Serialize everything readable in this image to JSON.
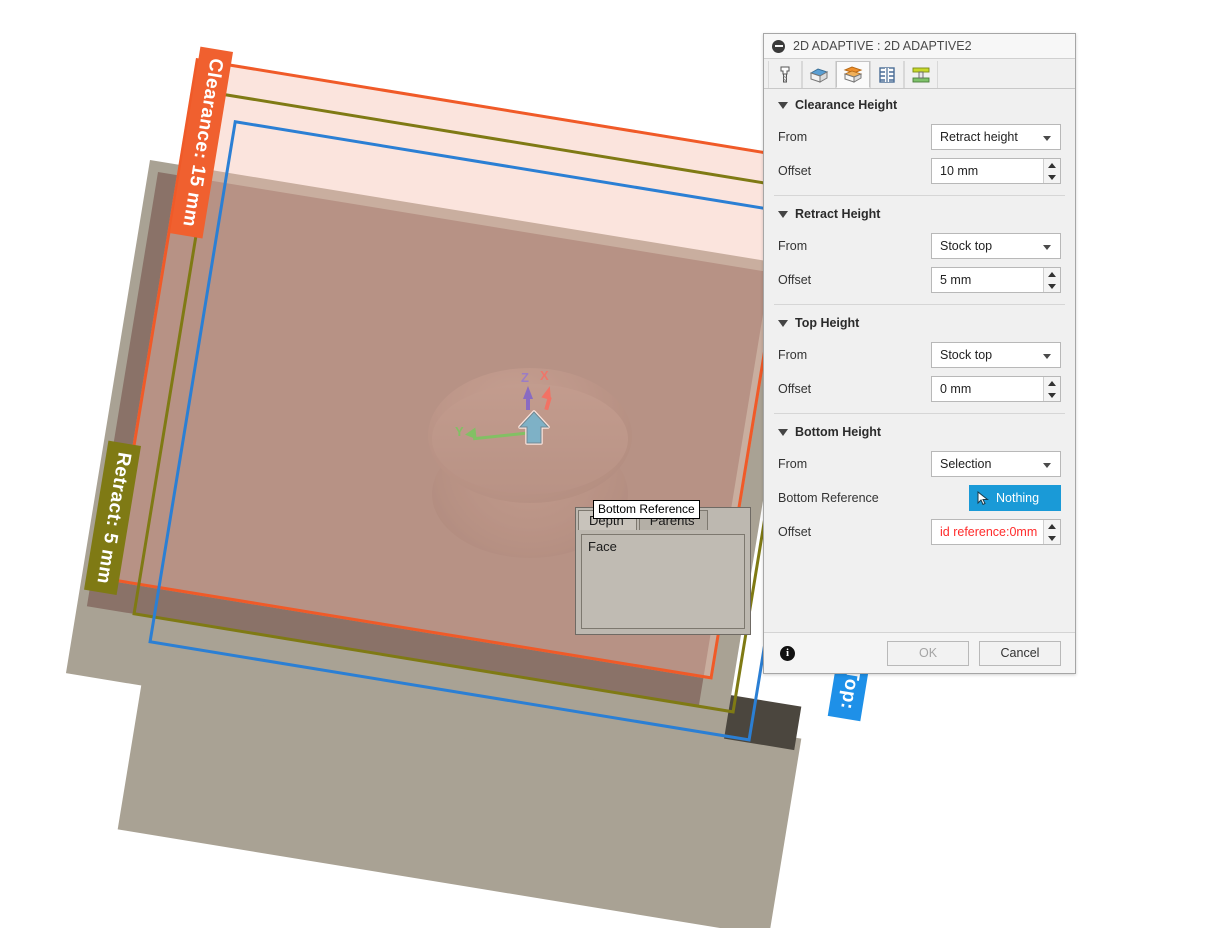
{
  "dialog": {
    "title": "2D ADAPTIVE : 2D ADAPTIVE2",
    "collapse_icon": "collapse-icon",
    "tabs": [
      {
        "name": "tool",
        "icon": "tool-icon",
        "active": false
      },
      {
        "name": "geometry",
        "icon": "geometry-icon",
        "active": false
      },
      {
        "name": "heights",
        "icon": "heights-icon",
        "active": true
      },
      {
        "name": "passes",
        "icon": "passes-icon",
        "active": false
      },
      {
        "name": "linking",
        "icon": "linking-icon",
        "active": false
      }
    ],
    "sections": [
      {
        "title": "Clearance Height",
        "from_label": "From",
        "from_value": "Retract height",
        "offset_label": "Offset",
        "offset_value": "10 mm"
      },
      {
        "title": "Retract Height",
        "from_label": "From",
        "from_value": "Stock top",
        "offset_label": "Offset",
        "offset_value": "5 mm"
      },
      {
        "title": "Top Height",
        "from_label": "From",
        "from_value": "Stock top",
        "offset_label": "Offset",
        "offset_value": "0 mm"
      },
      {
        "title": "Bottom Height",
        "from_label": "From",
        "from_value": "Selection",
        "reference_label": "Bottom Reference",
        "reference_value": "Nothing",
        "offset_label": "Offset",
        "offset_value": "id reference:0mm"
      }
    ],
    "footer": {
      "info_icon": "info-icon",
      "ok_label": "OK",
      "cancel_label": "Cancel"
    },
    "colors": {
      "selection_blue": "#1a9ad7",
      "error_red": "#ff2b2b"
    }
  },
  "popup": {
    "tooltip": "Bottom Reference",
    "tabs": [
      {
        "label": "Depth",
        "active": true
      },
      {
        "label": "Parents",
        "active": false
      }
    ],
    "body_item": "Face"
  },
  "viewport": {
    "plane_labels": [
      {
        "text": "Clearance: 15 mm",
        "color": "#f0602f"
      },
      {
        "text": "Retract: 5 mm",
        "color": "#7f7a14"
      },
      {
        "text": "Top:",
        "color": "#1e90e8"
      }
    ],
    "axes": [
      {
        "label": "Z",
        "color": "#5b4fd6"
      },
      {
        "label": "X",
        "color": "#e8433a"
      },
      {
        "label": "Y",
        "color": "#2fc12f"
      }
    ]
  }
}
